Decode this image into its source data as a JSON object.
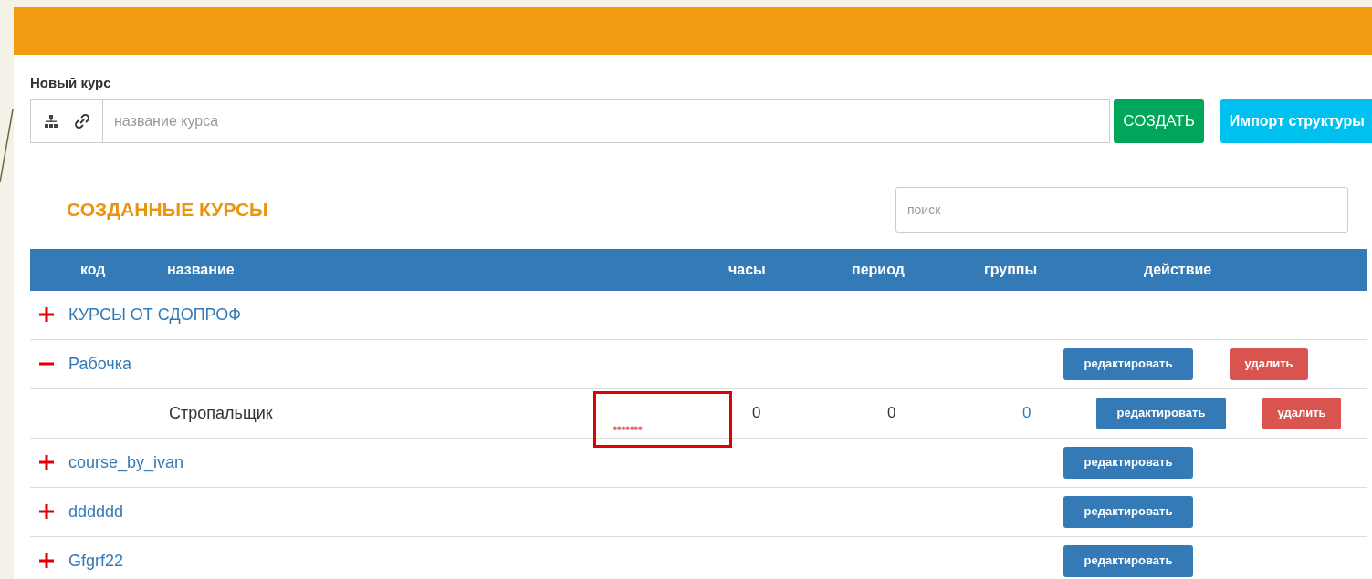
{
  "new_course": {
    "label": "Новый курс",
    "placeholder": "название курса",
    "create_button": "СОЗДАТЬ",
    "import_button": "Импорт структуры"
  },
  "created": {
    "title": "СОЗДАННЫЕ КУРСЫ",
    "search_placeholder": "поиск"
  },
  "table": {
    "columns": [
      "код",
      "название",
      "часы",
      "период",
      "группы",
      "действие"
    ],
    "rows": [
      {
        "kind": "group",
        "name": "КУРСЫ ОТ СДОПРОФ",
        "expanded": false,
        "buttons": []
      },
      {
        "kind": "group",
        "name": "Рабочка",
        "expanded": true,
        "buttons": [
          "редактировать",
          "удалить"
        ]
      },
      {
        "kind": "course",
        "name": "Стропальщик",
        "code": "•••••••",
        "highlighted": true,
        "hours": "0",
        "period": "0",
        "groups": "0",
        "buttons": [
          "редактировать",
          "удалить"
        ]
      },
      {
        "kind": "group",
        "name": "course_by_ivan",
        "expanded": false,
        "buttons": [
          "редактировать"
        ]
      },
      {
        "kind": "group",
        "name": "dddddd",
        "expanded": false,
        "buttons": [
          "редактировать"
        ]
      },
      {
        "kind": "group",
        "name": "Gfgrf22",
        "expanded": false,
        "buttons": [
          "редактировать"
        ]
      }
    ]
  }
}
